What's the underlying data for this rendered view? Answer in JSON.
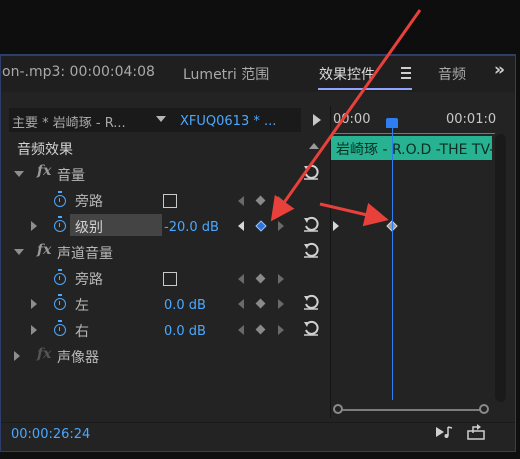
{
  "tabs": [
    {
      "label": "on-.mp3: 00:00:04:08"
    },
    {
      "label": "Lumetri 范围"
    },
    {
      "label": "效果控件"
    },
    {
      "label": "音频"
    }
  ],
  "source": {
    "master_label": "主要 * 岩崎琢 - R...",
    "clip_label": "XFUQ0613 * ..."
  },
  "timeline": {
    "time_start": "00:00",
    "time_end": "00:01:0",
    "clip_label": "岩崎琢 - R.O.D -THE TV-"
  },
  "sections": {
    "audio_effects": "音频效果",
    "volume": "音量",
    "bypass_1": "旁路",
    "level": "级别",
    "level_value": "-20.0 dB",
    "channel_volume": "声道音量",
    "bypass_2": "旁路",
    "left": "左",
    "left_value": "0.0 dB",
    "right": "右",
    "right_value": "0.0 dB",
    "panner": "声像器",
    "fx_glyph": "fx"
  },
  "footer": {
    "timecode": "00:00:26:24"
  },
  "colors": {
    "accent": "#4aa8ff",
    "clip": "#27b391",
    "playhead": "#2f7ef1",
    "annotation": "#e8403a"
  }
}
